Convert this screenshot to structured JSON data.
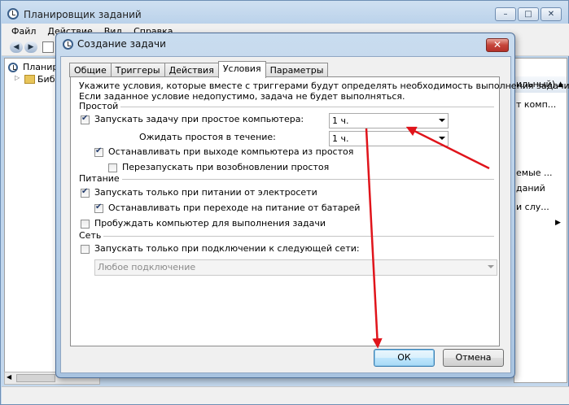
{
  "main_window": {
    "title": "Планировщик заданий",
    "menu": [
      "Файл",
      "Действие",
      "Вид",
      "Справка"
    ],
    "buttons": {
      "minimize": "–",
      "maximize": "□",
      "close": "✕"
    },
    "tree": {
      "root": "Планир",
      "child": "Библ"
    },
    "right_pane": {
      "header": "ильный)",
      "items": [
        "т комп...",
        "емые ...",
        "даний",
        "и слу..."
      ]
    }
  },
  "dialog": {
    "title": "Создание задачи",
    "close_label": "✕",
    "tabs": [
      "Общие",
      "Триггеры",
      "Действия",
      "Условия",
      "Параметры"
    ],
    "active_tab": "Условия",
    "description": [
      "Укажите условия, которые вместе с триггерами будут определять необходимость выполнения задачи.",
      "Если заданное условие недопустимо, задача не будет выполняться."
    ],
    "groups": {
      "idle": "Простой",
      "power": "Питание",
      "network": "Сеть"
    },
    "idle": {
      "start_if_idle": {
        "label": "Запускать задачу при простое компьютера:",
        "checked": true,
        "value": "1 ч."
      },
      "wait_for_idle": {
        "label": "Ожидать простоя в течение:",
        "value": "1 ч."
      },
      "stop_on_resume": {
        "label": "Останавливать при выходе компьютера из простоя",
        "checked": true
      },
      "restart_on_idle": {
        "label": "Перезапускать при возобновлении простоя",
        "checked": false
      }
    },
    "power": {
      "ac_only": {
        "label": "Запускать только при питании от электросети",
        "checked": true
      },
      "stop_on_battery": {
        "label": "Останавливать при переходе на питание от батарей",
        "checked": true
      },
      "wake": {
        "label": "Пробуждать компьютер для выполнения задачи",
        "checked": false
      }
    },
    "network": {
      "only_on_network": {
        "label": "Запускать только при подключении к следующей сети:",
        "checked": false
      },
      "connection": {
        "value": "Любое подключение"
      }
    },
    "ok_label": "ОК",
    "cancel_label": "Отмена"
  },
  "colors": {
    "annotation_arrow": "#e0141b",
    "dialog_frame": "#a8c3e0",
    "close_button": "#c5453a"
  }
}
